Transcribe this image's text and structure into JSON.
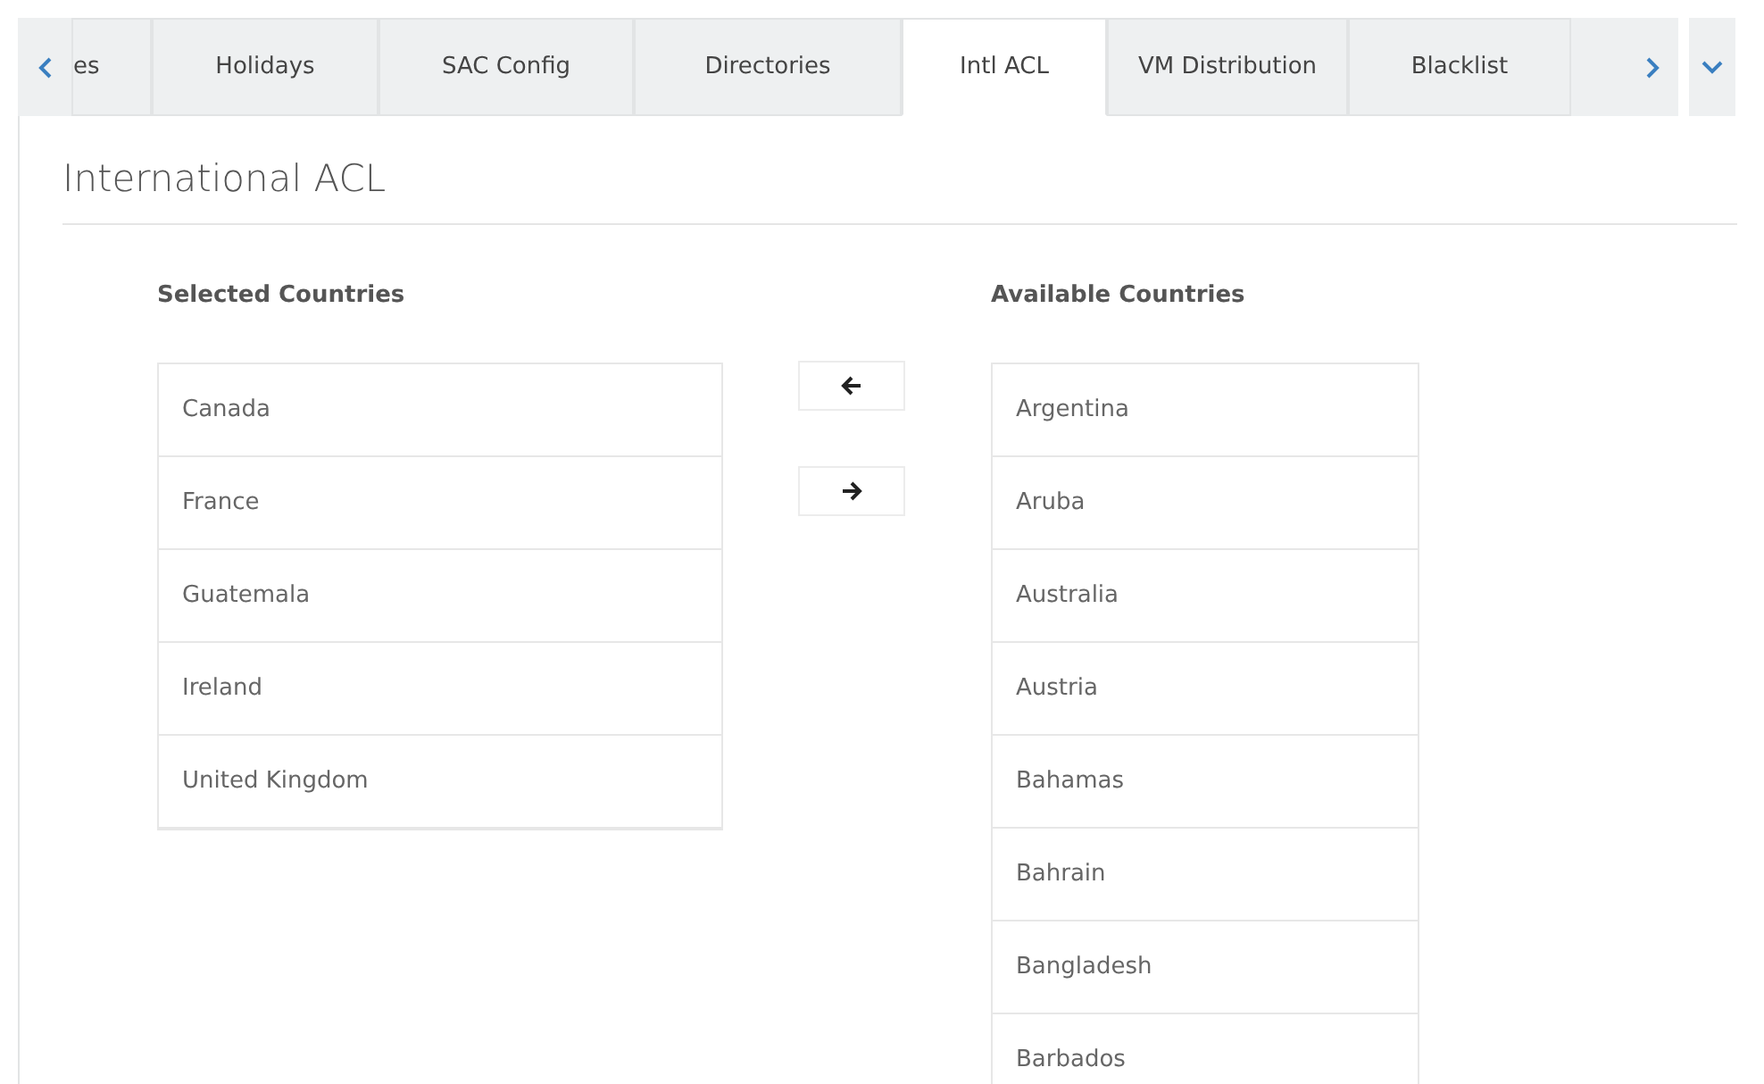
{
  "tabs": [
    {
      "label": "es",
      "selected": false
    },
    {
      "label": "Holidays",
      "selected": false
    },
    {
      "label": "SAC Config",
      "selected": false
    },
    {
      "label": "Directories",
      "selected": false
    },
    {
      "label": "Intl ACL",
      "selected": true
    },
    {
      "label": "VM Distribution",
      "selected": false
    },
    {
      "label": "Blacklist",
      "selected": false
    }
  ],
  "heading": "International ACL",
  "selected_countries": {
    "title": "Selected Countries",
    "items": [
      "Canada",
      "France",
      "Guatemala",
      "Ireland",
      "United Kingdom"
    ]
  },
  "available_countries": {
    "title": "Available Countries",
    "items": [
      "Argentina",
      "Aruba",
      "Australia",
      "Austria",
      "Bahamas",
      "Bahrain",
      "Bangladesh",
      "Barbados"
    ]
  }
}
